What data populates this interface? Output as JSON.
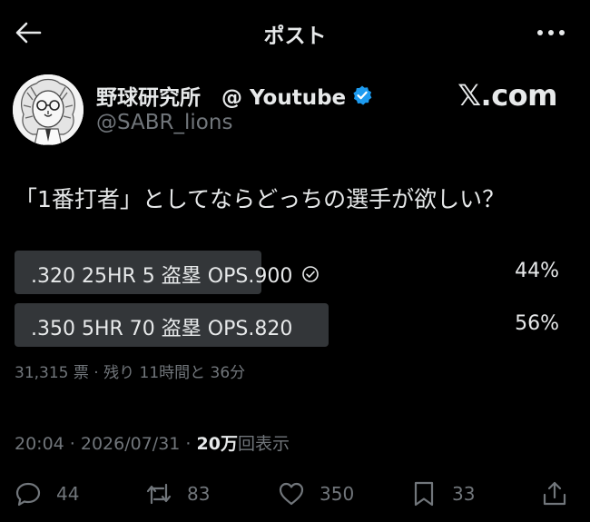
{
  "header": {
    "title": "ポスト",
    "back_icon": "back-arrow-icon",
    "more_icon": "more-dots-icon"
  },
  "author": {
    "display_name": "野球研究所　@ Youtube",
    "handle": "@SABR_lions",
    "verified": true,
    "verified_color": "#1d9bf0",
    "source_label": "𝕏.com"
  },
  "tweet": {
    "text": "「1番打者」としてならどっちの選手が欲しい？"
  },
  "poll": {
    "options": [
      {
        "label": ".320 25HR 5 盗塁 OPS.900",
        "percent_label": "44%",
        "percent": 44,
        "voted": true
      },
      {
        "label": ".350 5HR 70 盗塁 OPS.820",
        "percent_label": "56%",
        "percent": 56,
        "voted": false
      }
    ],
    "meta": "31,315 票 · 残り 11時間と 36分"
  },
  "timestamp": {
    "time_date": "20:04 · 2026/07/31 · ",
    "views_count": "20万",
    "views_label": "回表示"
  },
  "actions": {
    "reply_count": "44",
    "retweet_count": "83",
    "like_count": "350",
    "bookmark_count": "33"
  },
  "colors": {
    "background": "#000000",
    "text": "#e7e9ea",
    "muted": "#71767b",
    "poll_bar": "#333639",
    "accent": "#1d9bf0"
  }
}
